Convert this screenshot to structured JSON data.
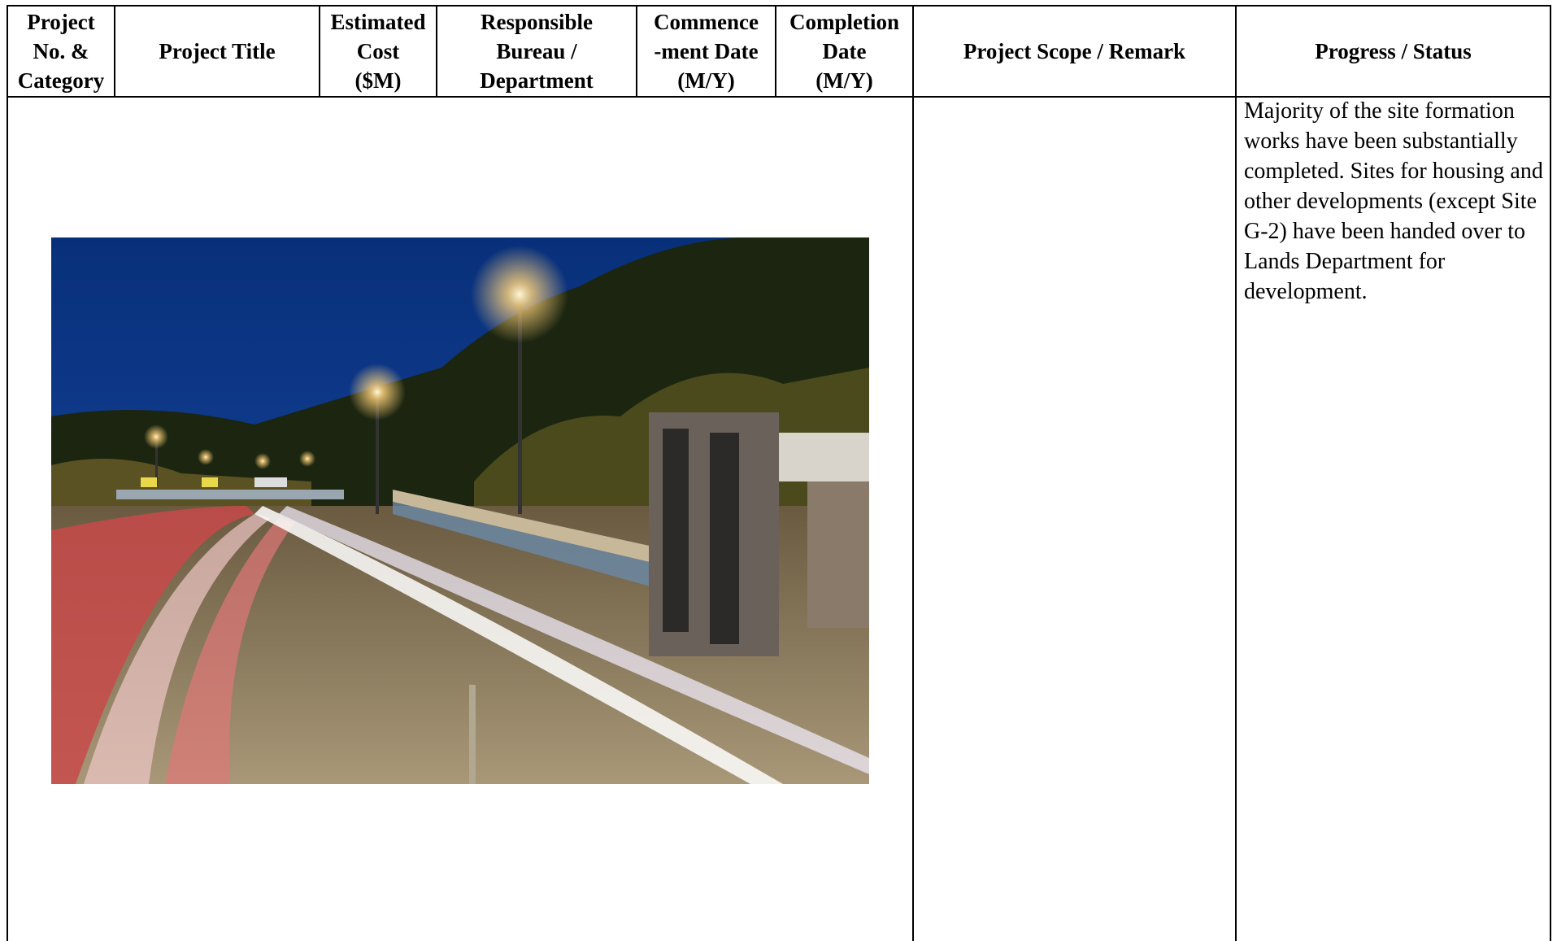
{
  "table": {
    "headers": [
      "Project No. & Category",
      "Project Title",
      "Estimated Cost ($M)",
      "Responsible Bureau / Department",
      "Commence -ment Date (M/Y)",
      "Completion Date (M/Y)",
      "Project Scope / Remark",
      "Progress / Status"
    ],
    "header_lines": [
      [
        "Project",
        "No. &",
        "Category"
      ],
      [
        "Project Title"
      ],
      [
        "Estimated",
        "Cost",
        "($M)"
      ],
      [
        "Responsible",
        "Bureau /",
        "Department"
      ],
      [
        "Commence",
        "-ment Date",
        "(M/Y)"
      ],
      [
        "Completion",
        "Date",
        "(M/Y)"
      ],
      [
        "Project Scope / Remark"
      ],
      [
        "Progress / Status"
      ]
    ],
    "row": {
      "progress_status": "Majority of the site formation works have been substantially completed. Sites for housing and other developments (except Site G-2) have been handed over to Lands Department for development."
    }
  },
  "photo": {
    "icon": "night-highway-photo",
    "colors": {
      "sky": "#0a3a8c",
      "trees": "#1d2a12",
      "road": "#8a7a5a",
      "light": "#ffd27a"
    }
  }
}
